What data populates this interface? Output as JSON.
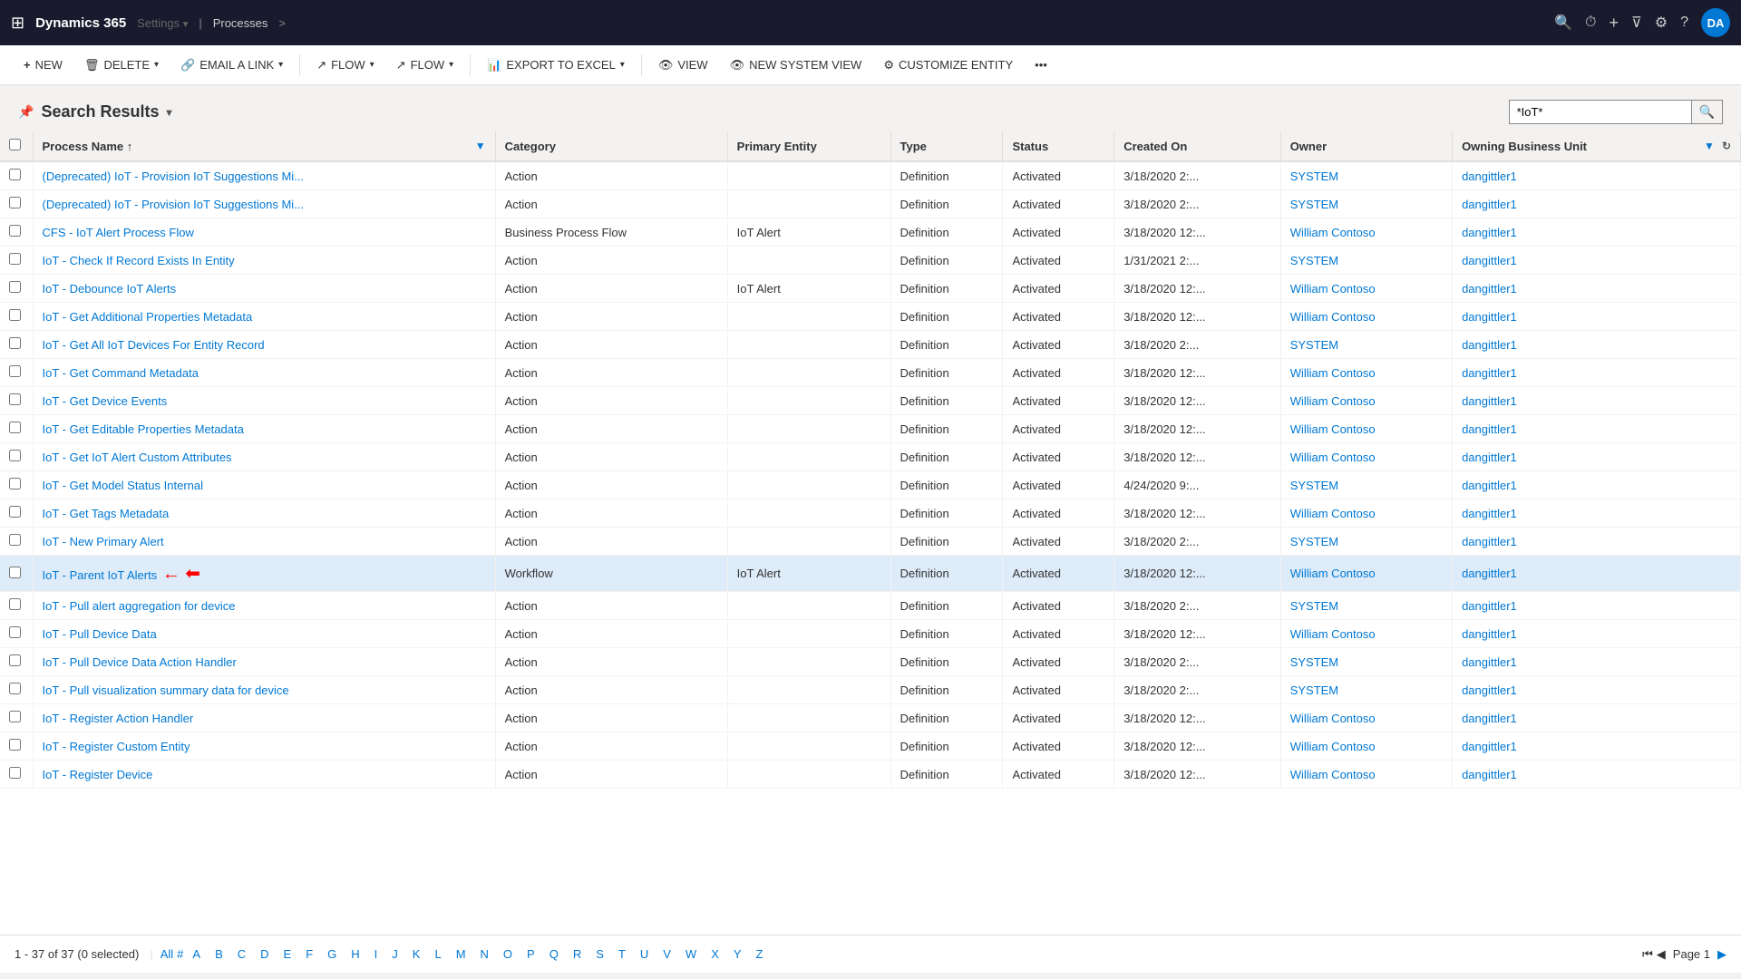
{
  "topNav": {
    "appName": "Dynamics 365",
    "settings": "Settings",
    "settingsArrow": "▾",
    "processes": "Processes",
    "processesArrow": ">",
    "icons": {
      "search": "🔍",
      "history": "⏱",
      "add": "+",
      "filter": "⊽",
      "settings": "⚙",
      "help": "?",
      "waffle": "⊞"
    },
    "avatarText": "DA"
  },
  "commandBar": {
    "buttons": [
      {
        "id": "new",
        "icon": "+",
        "label": "NEW"
      },
      {
        "id": "delete",
        "icon": "🗑",
        "label": "DELETE",
        "hasDropdown": true
      },
      {
        "id": "email-link",
        "icon": "🔗",
        "label": "EMAIL A LINK",
        "hasDropdown": true
      },
      {
        "id": "flow1",
        "icon": "↗",
        "label": "FLOW",
        "hasDropdown": true
      },
      {
        "id": "flow2",
        "icon": "↗",
        "label": "FLOW",
        "hasDropdown": true
      },
      {
        "id": "export",
        "icon": "📊",
        "label": "EXPORT TO EXCEL",
        "hasDropdown": true
      },
      {
        "id": "view",
        "icon": "👁",
        "label": "VIEW"
      },
      {
        "id": "new-system-view",
        "icon": "👁",
        "label": "NEW SYSTEM VIEW"
      },
      {
        "id": "customize-entity",
        "icon": "⚙",
        "label": "CUSTOMIZE ENTITY"
      },
      {
        "id": "more",
        "icon": "•••",
        "label": ""
      }
    ]
  },
  "searchHeader": {
    "pinIcon": "📌",
    "title": "Search Results",
    "dropdownIcon": "▾",
    "searchValue": "*IoT*",
    "searchPlaceholder": "*IoT*"
  },
  "table": {
    "columns": [
      {
        "id": "process-name",
        "label": "Process Name",
        "sortAsc": true
      },
      {
        "id": "category",
        "label": "Category"
      },
      {
        "id": "primary-entity",
        "label": "Primary Entity"
      },
      {
        "id": "type",
        "label": "Type"
      },
      {
        "id": "status",
        "label": "Status"
      },
      {
        "id": "created-on",
        "label": "Created On"
      },
      {
        "id": "owner",
        "label": "Owner"
      },
      {
        "id": "owning-business-unit",
        "label": "Owning Business Unit"
      }
    ],
    "rows": [
      {
        "processName": "(Deprecated) IoT - Provision IoT Suggestions Mi...",
        "category": "Action",
        "primaryEntity": "",
        "type": "Definition",
        "status": "Activated",
        "createdOn": "3/18/2020 2:...",
        "owner": "SYSTEM",
        "owningUnit": "dangittler1"
      },
      {
        "processName": "(Deprecated) IoT - Provision IoT Suggestions Mi...",
        "category": "Action",
        "primaryEntity": "",
        "type": "Definition",
        "status": "Activated",
        "createdOn": "3/18/2020 2:...",
        "owner": "SYSTEM",
        "owningUnit": "dangittler1"
      },
      {
        "processName": "CFS - IoT Alert Process Flow",
        "category": "Business Process Flow",
        "primaryEntity": "IoT Alert",
        "type": "Definition",
        "status": "Activated",
        "createdOn": "3/18/2020 12:...",
        "owner": "William Contoso",
        "owningUnit": "dangittler1"
      },
      {
        "processName": "IoT - Check If Record Exists In Entity",
        "category": "Action",
        "primaryEntity": "",
        "type": "Definition",
        "status": "Activated",
        "createdOn": "1/31/2021 2:...",
        "owner": "SYSTEM",
        "owningUnit": "dangittler1"
      },
      {
        "processName": "IoT - Debounce IoT Alerts",
        "category": "Action",
        "primaryEntity": "IoT Alert",
        "type": "Definition",
        "status": "Activated",
        "createdOn": "3/18/2020 12:...",
        "owner": "William Contoso",
        "owningUnit": "dangittler1"
      },
      {
        "processName": "IoT - Get Additional Properties Metadata",
        "category": "Action",
        "primaryEntity": "",
        "type": "Definition",
        "status": "Activated",
        "createdOn": "3/18/2020 12:...",
        "owner": "William Contoso",
        "owningUnit": "dangittler1"
      },
      {
        "processName": "IoT - Get All IoT Devices For Entity Record",
        "category": "Action",
        "primaryEntity": "",
        "type": "Definition",
        "status": "Activated",
        "createdOn": "3/18/2020 2:...",
        "owner": "SYSTEM",
        "owningUnit": "dangittler1"
      },
      {
        "processName": "IoT - Get Command Metadata",
        "category": "Action",
        "primaryEntity": "",
        "type": "Definition",
        "status": "Activated",
        "createdOn": "3/18/2020 12:...",
        "owner": "William Contoso",
        "owningUnit": "dangittler1"
      },
      {
        "processName": "IoT - Get Device Events",
        "category": "Action",
        "primaryEntity": "",
        "type": "Definition",
        "status": "Activated",
        "createdOn": "3/18/2020 12:...",
        "owner": "William Contoso",
        "owningUnit": "dangittler1"
      },
      {
        "processName": "IoT - Get Editable Properties Metadata",
        "category": "Action",
        "primaryEntity": "",
        "type": "Definition",
        "status": "Activated",
        "createdOn": "3/18/2020 12:...",
        "owner": "William Contoso",
        "owningUnit": "dangittler1"
      },
      {
        "processName": "IoT - Get IoT Alert Custom Attributes",
        "category": "Action",
        "primaryEntity": "",
        "type": "Definition",
        "status": "Activated",
        "createdOn": "3/18/2020 12:...",
        "owner": "William Contoso",
        "owningUnit": "dangittler1"
      },
      {
        "processName": "IoT - Get Model Status Internal",
        "category": "Action",
        "primaryEntity": "",
        "type": "Definition",
        "status": "Activated",
        "createdOn": "4/24/2020 9:...",
        "owner": "SYSTEM",
        "owningUnit": "dangittler1"
      },
      {
        "processName": "IoT - Get Tags Metadata",
        "category": "Action",
        "primaryEntity": "",
        "type": "Definition",
        "status": "Activated",
        "createdOn": "3/18/2020 12:...",
        "owner": "William Contoso",
        "owningUnit": "dangittler1"
      },
      {
        "processName": "IoT - New Primary Alert",
        "category": "Action",
        "primaryEntity": "",
        "type": "Definition",
        "status": "Activated",
        "createdOn": "3/18/2020 2:...",
        "owner": "SYSTEM",
        "owningUnit": "dangittler1",
        "hasArrow": true
      },
      {
        "processName": "IoT - Parent IoT Alerts",
        "category": "Workflow",
        "primaryEntity": "IoT Alert",
        "type": "Definition",
        "status": "Activated",
        "createdOn": "3/18/2020 12:...",
        "owner": "William Contoso",
        "owningUnit": "dangittler1",
        "highlighted": true
      },
      {
        "processName": "IoT - Pull alert aggregation for device",
        "category": "Action",
        "primaryEntity": "",
        "type": "Definition",
        "status": "Activated",
        "createdOn": "3/18/2020 2:...",
        "owner": "SYSTEM",
        "owningUnit": "dangittler1"
      },
      {
        "processName": "IoT - Pull Device Data",
        "category": "Action",
        "primaryEntity": "",
        "type": "Definition",
        "status": "Activated",
        "createdOn": "3/18/2020 12:...",
        "owner": "William Contoso",
        "owningUnit": "dangittler1"
      },
      {
        "processName": "IoT - Pull Device Data Action Handler",
        "category": "Action",
        "primaryEntity": "",
        "type": "Definition",
        "status": "Activated",
        "createdOn": "3/18/2020 2:...",
        "owner": "SYSTEM",
        "owningUnit": "dangittler1"
      },
      {
        "processName": "IoT - Pull visualization summary data for device",
        "category": "Action",
        "primaryEntity": "",
        "type": "Definition",
        "status": "Activated",
        "createdOn": "3/18/2020 2:...",
        "owner": "SYSTEM",
        "owningUnit": "dangittler1"
      },
      {
        "processName": "IoT - Register Action Handler",
        "category": "Action",
        "primaryEntity": "",
        "type": "Definition",
        "status": "Activated",
        "createdOn": "3/18/2020 12:...",
        "owner": "William Contoso",
        "owningUnit": "dangittler1"
      },
      {
        "processName": "IoT - Register Custom Entity",
        "category": "Action",
        "primaryEntity": "",
        "type": "Definition",
        "status": "Activated",
        "createdOn": "3/18/2020 12:...",
        "owner": "William Contoso",
        "owningUnit": "dangittler1"
      },
      {
        "processName": "IoT - Register Device",
        "category": "Action",
        "primaryEntity": "",
        "type": "Definition",
        "status": "Activated",
        "createdOn": "3/18/2020 12:...",
        "owner": "William Contoso",
        "owningUnit": "dangittler1"
      }
    ]
  },
  "statusBar": {
    "info": "1 - 37 of 37 (0 selected)",
    "all": "All",
    "hash": "#",
    "letters": [
      "A",
      "B",
      "C",
      "D",
      "E",
      "F",
      "G",
      "H",
      "I",
      "J",
      "K",
      "L",
      "M",
      "N",
      "O",
      "P",
      "Q",
      "R",
      "S",
      "T",
      "U",
      "V",
      "W",
      "X",
      "Y",
      "Z"
    ],
    "pageLabel": "Page 1",
    "prevFirst": "⏮",
    "prev": "◀",
    "next": "▶",
    "nextLast": "⏭"
  }
}
